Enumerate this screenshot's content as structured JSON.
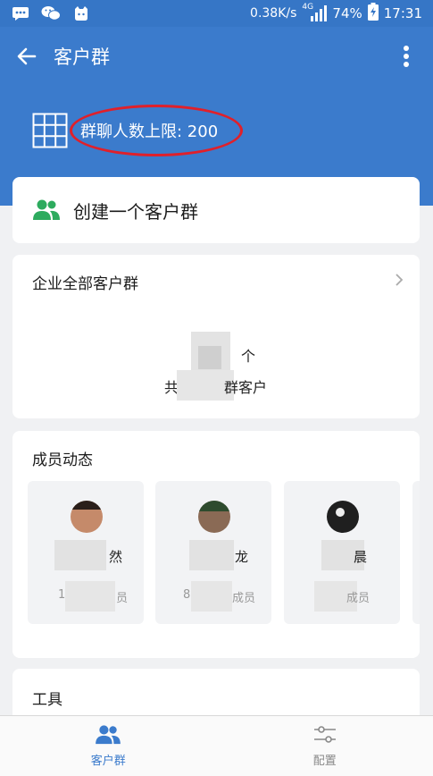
{
  "status_bar": {
    "speed": "0.38K/s",
    "network": "4G",
    "battery": "74%",
    "time": "17:31"
  },
  "appbar": {
    "title": "客户群"
  },
  "limit": {
    "text": "群聊人数上限: 200"
  },
  "create": {
    "label": "创建一个客户群"
  },
  "groups": {
    "title": "企业全部客户群",
    "count_suffix": "个",
    "desc_left": "共",
    "desc_right": "群客户"
  },
  "members": {
    "title": "成员动态",
    "items": [
      {
        "name": "然",
        "sub_prefix": "1",
        "sub_suffix": "员"
      },
      {
        "name": "龙",
        "sub_prefix": "8",
        "sub_suffix": "成员"
      },
      {
        "name": "晨",
        "sub_prefix": "",
        "sub_suffix": "成员"
      }
    ]
  },
  "tools": {
    "title": "工具"
  },
  "tabs": [
    {
      "label": "客户群",
      "icon": "people-icon",
      "active": true
    },
    {
      "label": "配置",
      "icon": "sliders-icon",
      "active": false
    }
  ],
  "colors": {
    "brand_blue": "#3b7bcc",
    "annotation_red": "#e0202a"
  }
}
